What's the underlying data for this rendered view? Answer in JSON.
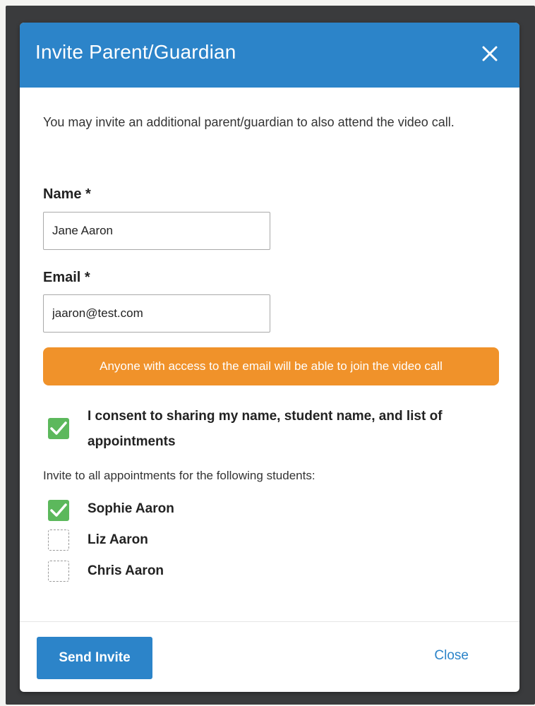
{
  "dialog": {
    "title": "Invite Parent/Guardian",
    "intro": "You may invite an additional parent/guardian to also attend the video call."
  },
  "form": {
    "name_label": "Name *",
    "name_value": "Jane Aaron",
    "email_label": "Email *",
    "email_value": "jaaron@test.com",
    "warning": "Anyone with access to the email will be able to join the video call",
    "consent": {
      "label": "I consent to sharing my name, student name, and list of appointments",
      "checked": true
    },
    "students_title": "Invite to all appointments for the following students:",
    "students": [
      {
        "name": "Sophie Aaron",
        "checked": true
      },
      {
        "name": "Liz Aaron",
        "checked": false
      },
      {
        "name": "Chris Aaron",
        "checked": false
      }
    ]
  },
  "footer": {
    "send_label": "Send Invite",
    "close_label": "Close"
  },
  "colors": {
    "header": "#2c84c9",
    "warning": "#f0922a",
    "check": "#5cb85c"
  },
  "icons": {
    "close": "close-icon",
    "check": "checkmark-icon"
  }
}
